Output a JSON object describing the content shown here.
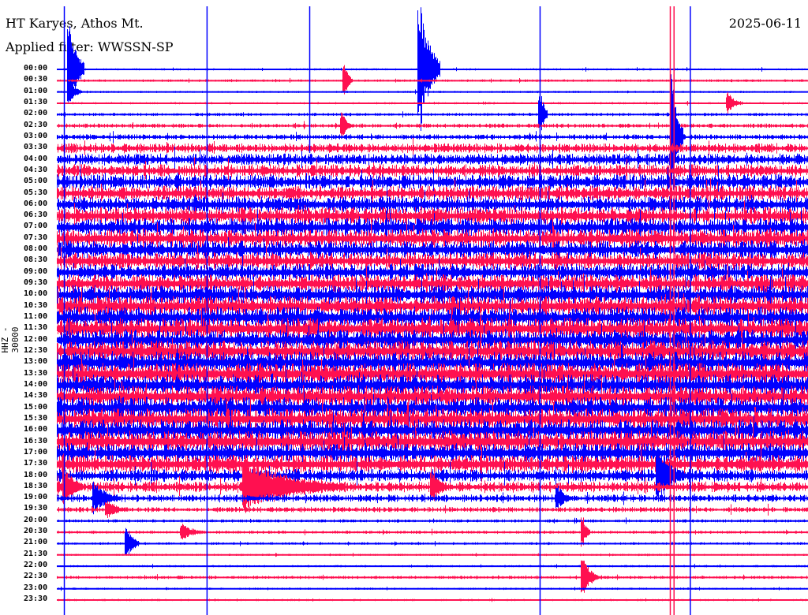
{
  "header": {
    "station": "HT Karyes, Athos Mt.",
    "filter": "Applied filter: WWSSN-SP",
    "date": "2025-06-11"
  },
  "chart_data": {
    "type": "line",
    "title": "HT Karyes, Athos Mt.",
    "ylabel": "HHZ - 30000",
    "xlabel": "",
    "x_unit": "minutes within row",
    "xlim": [
      0,
      30
    ],
    "row_labels": [
      "00:00",
      "00:30",
      "01:00",
      "01:30",
      "02:00",
      "02:30",
      "03:00",
      "03:30",
      "04:00",
      "04:30",
      "05:00",
      "05:30",
      "06:00",
      "06:30",
      "07:00",
      "07:30",
      "08:00",
      "08:30",
      "09:00",
      "09:30",
      "10:00",
      "10:30",
      "11:00",
      "11:30",
      "12:00",
      "12:30",
      "13:00",
      "13:30",
      "14:00",
      "14:30",
      "15:00",
      "15:30",
      "16:00",
      "16:30",
      "17:00",
      "17:30",
      "18:00",
      "18:30",
      "19:00",
      "19:30",
      "20:00",
      "20:30",
      "21:00",
      "21:30",
      "22:00",
      "22:30",
      "23:00",
      "23:30"
    ],
    "series_colors": [
      "#0000ff",
      "#ff1050"
    ],
    "noise_amplitude_rel": [
      0.1,
      0.12,
      0.1,
      0.1,
      0.15,
      0.2,
      0.25,
      0.45,
      0.55,
      0.6,
      0.7,
      0.7,
      0.75,
      0.8,
      0.85,
      0.85,
      0.85,
      0.8,
      0.8,
      0.85,
      0.9,
      0.95,
      1.0,
      1.0,
      0.95,
      1.0,
      1.0,
      1.0,
      1.0,
      1.0,
      1.0,
      1.0,
      1.0,
      1.0,
      0.9,
      0.85,
      0.6,
      0.5,
      0.35,
      0.25,
      0.15,
      0.15,
      0.12,
      0.1,
      0.1,
      0.15,
      0.1,
      0.1
    ],
    "events": [
      {
        "row": 0,
        "minute": 0.5,
        "amp": 4.5,
        "len": 0.6
      },
      {
        "row": 2,
        "minute": 0.5,
        "amp": 1.2,
        "len": 0.5
      },
      {
        "row": 0,
        "minute": 14.5,
        "amp": 6,
        "len": 0.8
      },
      {
        "row": 1,
        "minute": 11.5,
        "amp": 1.5,
        "len": 0.3
      },
      {
        "row": 4,
        "minute": 19.3,
        "amp": 2.5,
        "len": 0.3
      },
      {
        "row": 5,
        "minute": 11.4,
        "amp": 1.2,
        "len": 0.4
      },
      {
        "row": 3,
        "minute": 26.8,
        "amp": 1,
        "len": 0.6
      },
      {
        "row": 6,
        "minute": 24.6,
        "amp": 6,
        "len": 0.4
      },
      {
        "row": 37,
        "minute": 7.5,
        "amp": 2.5,
        "len": 4
      },
      {
        "row": 37,
        "minute": 0.3,
        "amp": 2,
        "len": 0.8
      },
      {
        "row": 38,
        "minute": 1.5,
        "amp": 1.5,
        "len": 1
      },
      {
        "row": 37,
        "minute": 15,
        "amp": 1.5,
        "len": 0.8
      },
      {
        "row": 38,
        "minute": 20,
        "amp": 1.2,
        "len": 0.6
      },
      {
        "row": 39,
        "minute": 2,
        "amp": 1,
        "len": 0.8
      },
      {
        "row": 42,
        "minute": 2.8,
        "amp": 1.5,
        "len": 0.5
      },
      {
        "row": 41,
        "minute": 5,
        "amp": 0.8,
        "len": 1
      },
      {
        "row": 41,
        "minute": 21,
        "amp": 1.5,
        "len": 0.3
      },
      {
        "row": 45,
        "minute": 21,
        "amp": 2,
        "len": 0.6
      },
      {
        "row": 36,
        "minute": 24,
        "amp": 3,
        "len": 1
      }
    ],
    "spikes": [
      {
        "minute": 6.0,
        "from_row": 0,
        "to_row": 47,
        "color": "#0000ff"
      },
      {
        "minute": 10.1,
        "from_row": 0,
        "to_row": 6,
        "color": "#0000ff"
      },
      {
        "minute": 19.3,
        "from_row": 0,
        "to_row": 47,
        "color": "#0000ff"
      },
      {
        "minute": 24.5,
        "from_row": 0,
        "to_row": 47,
        "color": "#ff1050"
      },
      {
        "minute": 24.65,
        "from_row": 0,
        "to_row": 47,
        "color": "#ff1050"
      },
      {
        "minute": 25.3,
        "from_row": 0,
        "to_row": 47,
        "color": "#0000ff"
      },
      {
        "minute": 0.3,
        "from_row": 0,
        "to_row": 47,
        "color": "#0000ff"
      }
    ]
  }
}
